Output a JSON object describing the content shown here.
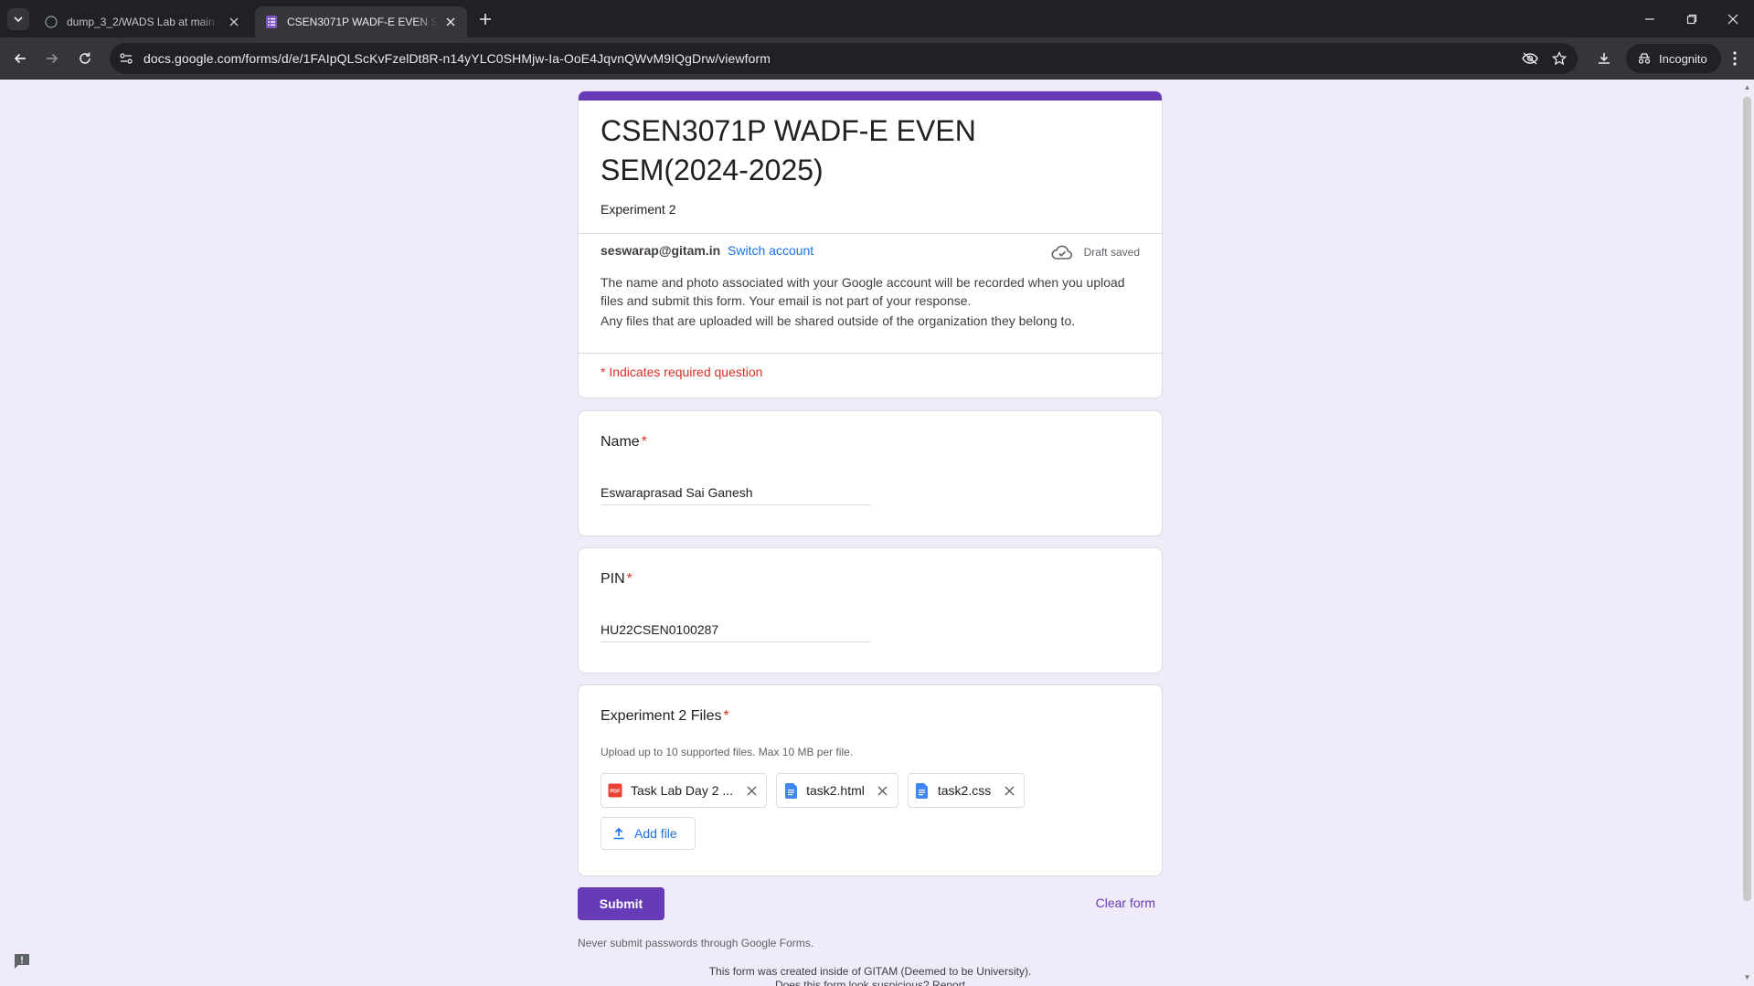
{
  "browser": {
    "tabs": [
      {
        "title": "dump_3_2/WADS Lab at main ·"
      },
      {
        "title": "CSEN3071P WADF-E EVEN SEM"
      }
    ],
    "url": "docs.google.com/forms/d/e/1FAIpQLScKvFzelDt8R-n14yYLC0SHMjw-Ia-OoE4JqvnQWvM9IQgDrw/viewform",
    "incognito_label": "Incognito"
  },
  "form": {
    "title": "CSEN3071P WADF-E EVEN SEM(2024-2025)",
    "description": "Experiment 2",
    "account_email": "seswarap@gitam.in",
    "switch_account": "Switch account",
    "draft_status": "Draft saved",
    "notice_1": "The name and photo associated with your Google account will be recorded when you upload files and submit this form. Your email is not part of your response.",
    "notice_2": "Any files that are uploaded will be shared outside of the organization they belong to.",
    "required_note": "* Indicates required question",
    "accent_color": "#673ab7"
  },
  "questions": {
    "name": {
      "label": "Name",
      "star": "*",
      "value": "Eswaraprasad Sai Ganesh"
    },
    "pin": {
      "label": "PIN",
      "star": "*",
      "value": "HU22CSEN0100287"
    },
    "files": {
      "label": "Experiment 2 Files",
      "star": "*",
      "help": "Upload up to 10 supported files. Max 10 MB per file.",
      "uploaded": [
        {
          "name": "Task Lab Day 2 ...",
          "type": "pdf-icon"
        },
        {
          "name": "task2.html",
          "type": "doc-icon"
        },
        {
          "name": "task2.css",
          "type": "doc-icon"
        }
      ],
      "add_file": "Add file"
    }
  },
  "actions": {
    "submit": "Submit",
    "clear": "Clear form"
  },
  "footer": {
    "never_submit": "Never submit passwords through Google Forms.",
    "created": "This form was created inside of GITAM (Deemed to be University).",
    "suspicious": "Does this form look suspicious? Report"
  }
}
